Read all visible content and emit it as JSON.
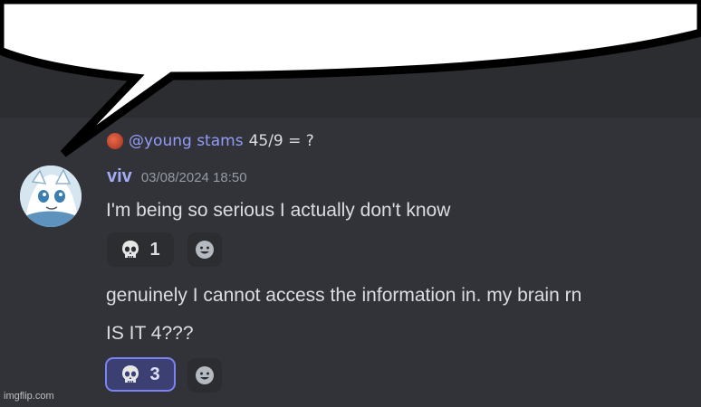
{
  "reply": {
    "mention": "@young stams",
    "text": "45/9 = ?"
  },
  "message": {
    "username": "viv",
    "timestamp": "03/08/2024 18:50",
    "lines": [
      "I'm being so serious I actually don't know",
      "genuinely I cannot access the information in. my brain rn",
      "IS IT 4???"
    ]
  },
  "reactions": [
    {
      "emoji": "skull-icon",
      "count": "1",
      "active": false
    },
    {
      "emoji": "skull-icon",
      "count": "3",
      "active": true
    }
  ],
  "watermark": "imgflip.com",
  "colors": {
    "background": "#313338",
    "username": "#a5adf6",
    "mention": "#949cf7",
    "text": "#dbdee1",
    "timestamp": "#949ba4",
    "reaction_bg": "#2b2d31",
    "reaction_active_border": "#7c83f0"
  }
}
